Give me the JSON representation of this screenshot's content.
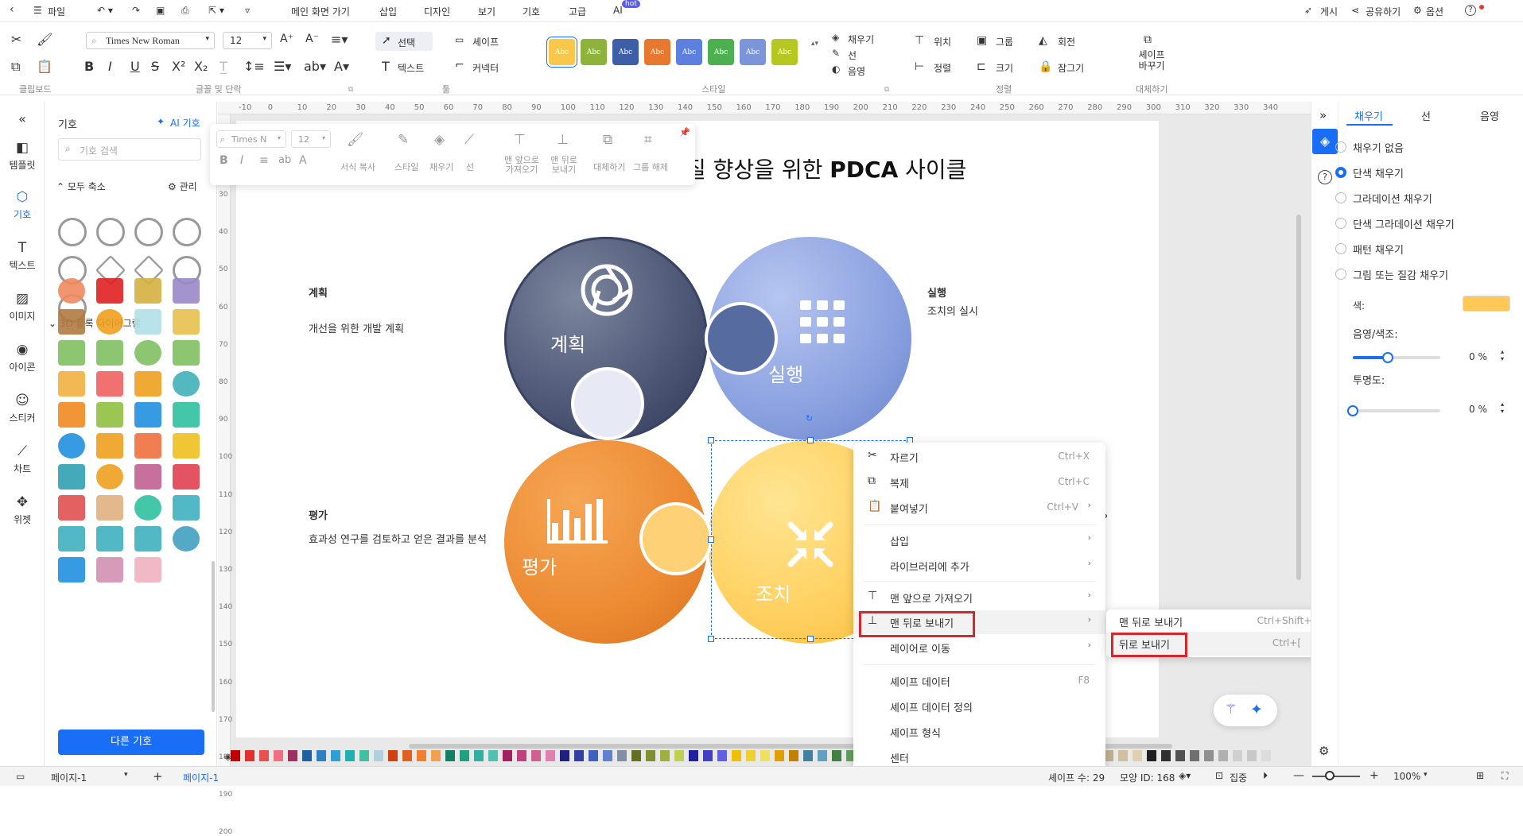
{
  "topbar": {
    "file": "파일",
    "tabs": [
      "메인 화면 가기",
      "삽입",
      "디자인",
      "보기",
      "기호",
      "고급",
      "AI"
    ],
    "ai_badge": "hot",
    "publish": "게시",
    "share": "공유하기",
    "options": "옵션",
    "help": "?"
  },
  "ribbon": {
    "font_name": "Times New Roman",
    "font_size": "12",
    "select": "선택",
    "shape": "셰이프",
    "text": "텍스트",
    "connector": "커넥터",
    "fill": "채우기",
    "line": "선",
    "shadow": "음영",
    "position": "위치",
    "group": "그룹",
    "rotate": "회전",
    "align": "정렬",
    "size": "크기",
    "lock": "잠그기",
    "replace_shape": "셰이프 바꾸기",
    "groups": {
      "clipboard": "클립보드",
      "font": "글꼴 및 단락",
      "tools": "툴",
      "style": "스타일",
      "arrange": "정렬",
      "replace": "대체하기"
    },
    "style_swatch": "Abc",
    "style_colors": [
      "#f9c84b",
      "#8db33a",
      "#3f5ea8",
      "#e8782e",
      "#5d7fe0",
      "#4caf50",
      "#7c94d8",
      "#b5c721"
    ]
  },
  "leftnav": [
    "템플릿",
    "기호",
    "텍스트",
    "이미지",
    "아이콘",
    "스티커",
    "차트",
    "위젯"
  ],
  "symbols": {
    "title": "기호",
    "ai": "AI 기호",
    "search_placeholder": "기호 검색",
    "collapse_all": "모두 축소",
    "manage": "관리",
    "section": "3D 블록 다이어그램",
    "more": "다른 기호"
  },
  "float_toolbar": {
    "font": "Times N",
    "size": "12",
    "format_copy": "서식 복사",
    "style": "스타일",
    "fill": "채우기",
    "line": "선",
    "bring_front": "맨 앞으로 가져오기",
    "send_back": "맨 뒤로 보내기",
    "replace": "대체하기",
    "ungroup": "그룹 해제"
  },
  "diagram": {
    "title_prefix": "질 향상을 위한 ",
    "title_bold": "PDCA",
    "title_suffix": " 사이클",
    "plan": "계획",
    "plan_desc": "개선을 위한 개발 계획",
    "do": "실행",
    "do_desc": "조치의 실시",
    "check": "평가",
    "check_desc": "효과성 연구를 검토하고 얻은 결과를 분석",
    "act": "조치",
    "q": "?"
  },
  "context_menu": [
    {
      "label": "자르기",
      "shortcut": "Ctrl+X",
      "icon": "scissors-icon"
    },
    {
      "label": "복제",
      "shortcut": "Ctrl+C",
      "icon": "copy-icon"
    },
    {
      "label": "붙여넣기",
      "shortcut": "Ctrl+V",
      "icon": "paste-icon",
      "arrow": true
    },
    {
      "label": "삽입",
      "arrow": true
    },
    {
      "label": "라이브러리에 추가",
      "arrow": true
    },
    {
      "label": "맨 앞으로 가져오기",
      "icon": "bring-front-icon",
      "arrow": true
    },
    {
      "label": "맨 뒤로 보내기",
      "icon": "send-back-icon",
      "arrow": true
    },
    {
      "label": "레이어로 이동",
      "arrow": true
    },
    {
      "label": "셰이프 데이터",
      "shortcut": "F8"
    },
    {
      "label": "셰이프 데이터 정의"
    },
    {
      "label": "셰이프 형식"
    },
    {
      "label": "센터"
    }
  ],
  "submenu": [
    {
      "label": "맨 뒤로 보내기",
      "shortcut": "Ctrl+Shift+["
    },
    {
      "label": "뒤로 보내기",
      "shortcut": "Ctrl+["
    }
  ],
  "rightpanel": {
    "tabs": [
      "채우기",
      "선",
      "음영"
    ],
    "options": [
      "채우기 없음",
      "단색 채우기",
      "그라데이션 채우기",
      "단색 그라데이션 채우기",
      "패턴 채우기",
      "그림 또는 질감 채우기"
    ],
    "color_label": "색:",
    "color_value": "#ffc857",
    "shade_label": "음영/색조:",
    "shade_value": "0 %",
    "transparency_label": "투명도:",
    "transparency_value": "0 %",
    "shade_level": 0.4,
    "transparency_level": 0
  },
  "bottombar": {
    "page_selector": "페이지-1",
    "page_tab": "페이지-1",
    "status": "셰이프 수: 29",
    "shape_id": "모양 ID: 168",
    "focus": "집중",
    "zoom": "100%"
  },
  "palette": [
    "#c00000",
    "#e03030",
    "#e85050",
    "#f07080",
    "#a03060",
    "#2060a0",
    "#3080c0",
    "#30a0d0",
    "#20b0b0",
    "#40c0a0",
    "#b0d0e0",
    "#d04010",
    "#e06020",
    "#f08030",
    "#f0a050",
    "#108060",
    "#20a080",
    "#30b0a0",
    "#50c0b0",
    "#a02060",
    "#c04080",
    "#d06090",
    "#e080b0",
    "#202080",
    "#3040a0",
    "#4060c0",
    "#6080d0",
    "#8090a0",
    "#607020",
    "#809030",
    "#a0b040",
    "#c0d050",
    "#2020a0",
    "#4040c0",
    "#6060e0",
    "#f0c000",
    "#f0d030",
    "#f0e060",
    "#e0a000",
    "#c08000",
    "#4080a0",
    "#60a0c0",
    "#408040",
    "#60a060",
    "#80c080",
    "#a0d0a0",
    "#205020",
    "#306030",
    "#407040",
    "#c03030",
    "#e05050",
    "#e07070",
    "#f0a0a0",
    "#404040",
    "#606060",
    "#808080",
    "#a0a0a0",
    "#c0c0c0",
    "#e0e0e0",
    "#f0f0f0",
    "#b0a080",
    "#c0b090",
    "#d0c0a0",
    "#e0d0b0",
    "#202020",
    "#303030",
    "#505050",
    "#707070",
    "#909090",
    "#b0b0b0",
    "#d0d0d0",
    "#c8c8c8",
    "#dcdcdc"
  ]
}
